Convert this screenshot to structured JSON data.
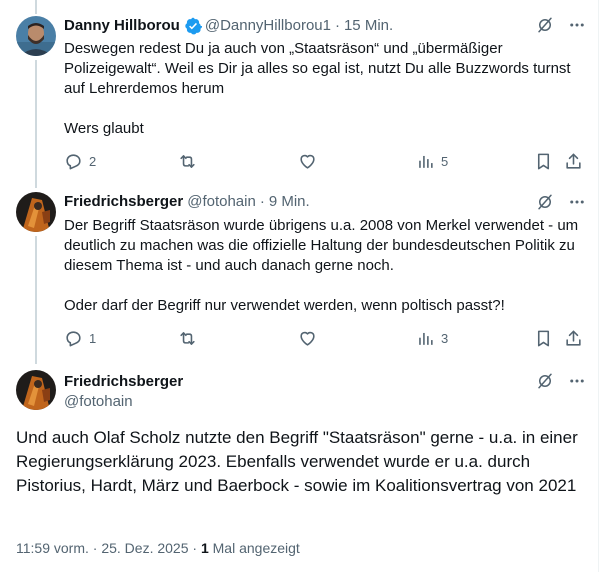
{
  "replies": [
    {
      "name": "Danny Hillborou",
      "handle": "@DannyHillborou1",
      "time": "15 Min.",
      "paragraphs": [
        "Deswegen redest Du ja auch von „Staatsräson“ und „übermäßiger Polizeigewalt“. Weil es Dir ja alles so egal ist, nutzt Du alle Buzzwords turnst auf Lehrerdemos herum",
        "Wers glaubt"
      ],
      "reply_count": "2",
      "views": "5"
    },
    {
      "name": "Friedrichsberger",
      "handle": "@fotohain",
      "time": "9 Min.",
      "paragraphs": [
        "Der Begriff Staatsräson wurde übrigens u.a. 2008 von Merkel verwendet - um deutlich zu machen was die offizielle Haltung der bundesdeutschen Politik zu diesem Thema ist - und auch danach gerne noch.",
        "Oder darf der Begriff nur verwendet werden, wenn poltisch passt?!"
      ],
      "reply_count": "1",
      "views": "3"
    }
  ],
  "main_post": {
    "name": "Friedrichsberger",
    "handle": "@fotohain",
    "text": "Und auch Olaf Scholz nutzte den Begriff \"Staatsräson\" gerne - u.a. in einer Regierungserklärung 2023. Ebenfalls verwendet wurde er u.a. durch  Pistorius, Hardt, März und Baerbock - sowie im Koalitionsvertrag von 2021",
    "timestamp": "11:59 vorm. · 25. Dez. 2025 · ",
    "view_count": "1",
    "view_label": " Mal angezeigt"
  },
  "colors": {
    "secondary_text": "#536471",
    "verified_blue": "#1d9bf0",
    "thread_line": "#cfd9de"
  },
  "icons": [
    "grok-icon",
    "more-icon",
    "reply-icon",
    "retweet-icon",
    "like-icon",
    "views-icon",
    "bookmark-icon",
    "share-icon",
    "verified-badge-icon"
  ]
}
